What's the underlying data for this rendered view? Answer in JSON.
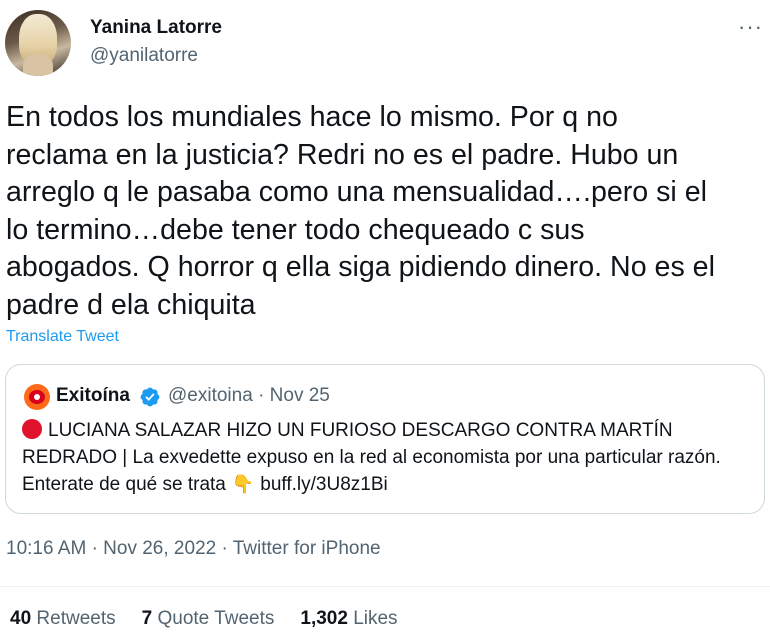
{
  "author": {
    "name": "Yanina Latorre",
    "handle": "@yanilatorre",
    "more_icon": "more-horizontal-icon"
  },
  "tweet": {
    "text": "En todos los mundiales hace lo mismo. Por q no\nreclama en la justicia? Redri no es el padre. Hubo un\narreglo q le pasaba como una mensualidad….pero si el\nlo termino…debe tener todo chequeado c sus\nabogados. Q horror q ella siga pidiendo dinero. No es el\npadre d ela chiquita",
    "translate_label": "Translate Tweet"
  },
  "quote": {
    "name": "Exitoína",
    "verified_icon": "verified-badge-icon",
    "handle": "@exitoina",
    "separator": "·",
    "date": "Nov 25",
    "body_before_emoji": "LUCIANA SALAZAR HIZO UN FURIOSO DESCARGO CONTRA MARTÍN REDRADO | La exvedette expuso en la red al economista por una particular razón. Enterate de qué se trata",
    "link": "buff.ly/3U8z1Bi",
    "accent_color": "#e0112b"
  },
  "meta": {
    "time": "10:16 AM",
    "dot": "·",
    "date": "Nov 26, 2022",
    "source": "Twitter for iPhone"
  },
  "stats": {
    "retweets_count": "40",
    "retweets_label": "Retweets",
    "quotes_count": "7",
    "quotes_label": "Quote Tweets",
    "likes_count": "1,302",
    "likes_label": "Likes"
  },
  "colors": {
    "link": "#1d9bf0",
    "secondary_text": "#536471",
    "primary_text": "#0f1419",
    "border": "#cfd9de"
  }
}
